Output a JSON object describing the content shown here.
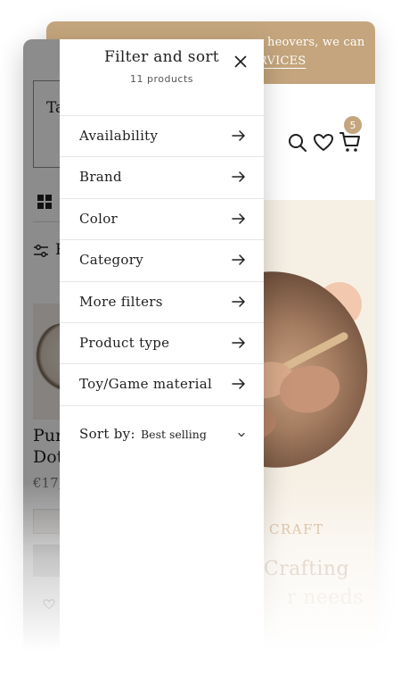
{
  "announcement": {
    "text": "heovers, we can",
    "link": "RVICES"
  },
  "header": {
    "cart_count": "5"
  },
  "hero": {
    "kicker": "CRAFT",
    "heading_line1": "Crafting",
    "heading_line2": "r needs"
  },
  "collection": {
    "search_text": "Ta",
    "filter_label": "F",
    "product_title_line1": "Pur",
    "product_title_line2": "Dot",
    "product_price": "€17,"
  },
  "drawer": {
    "title": "Filter and sort",
    "count": "11 products",
    "filters": [
      {
        "label": "Availability"
      },
      {
        "label": "Brand"
      },
      {
        "label": "Color"
      },
      {
        "label": "Category"
      },
      {
        "label": "More filters"
      },
      {
        "label": "Product type"
      },
      {
        "label": "Toy/Game material"
      }
    ],
    "sort_label": "Sort by:",
    "sort_value": "Best selling"
  },
  "colors": {
    "accent": "#c4a57d",
    "text": "#1f1f1f",
    "hero_bg": "#f6efe4"
  },
  "icons": {
    "close": "close-icon",
    "arrow": "arrow-right-icon",
    "search": "search-icon",
    "heart": "heart-icon",
    "cart": "cart-icon",
    "chevron": "chevron-down-icon"
  }
}
